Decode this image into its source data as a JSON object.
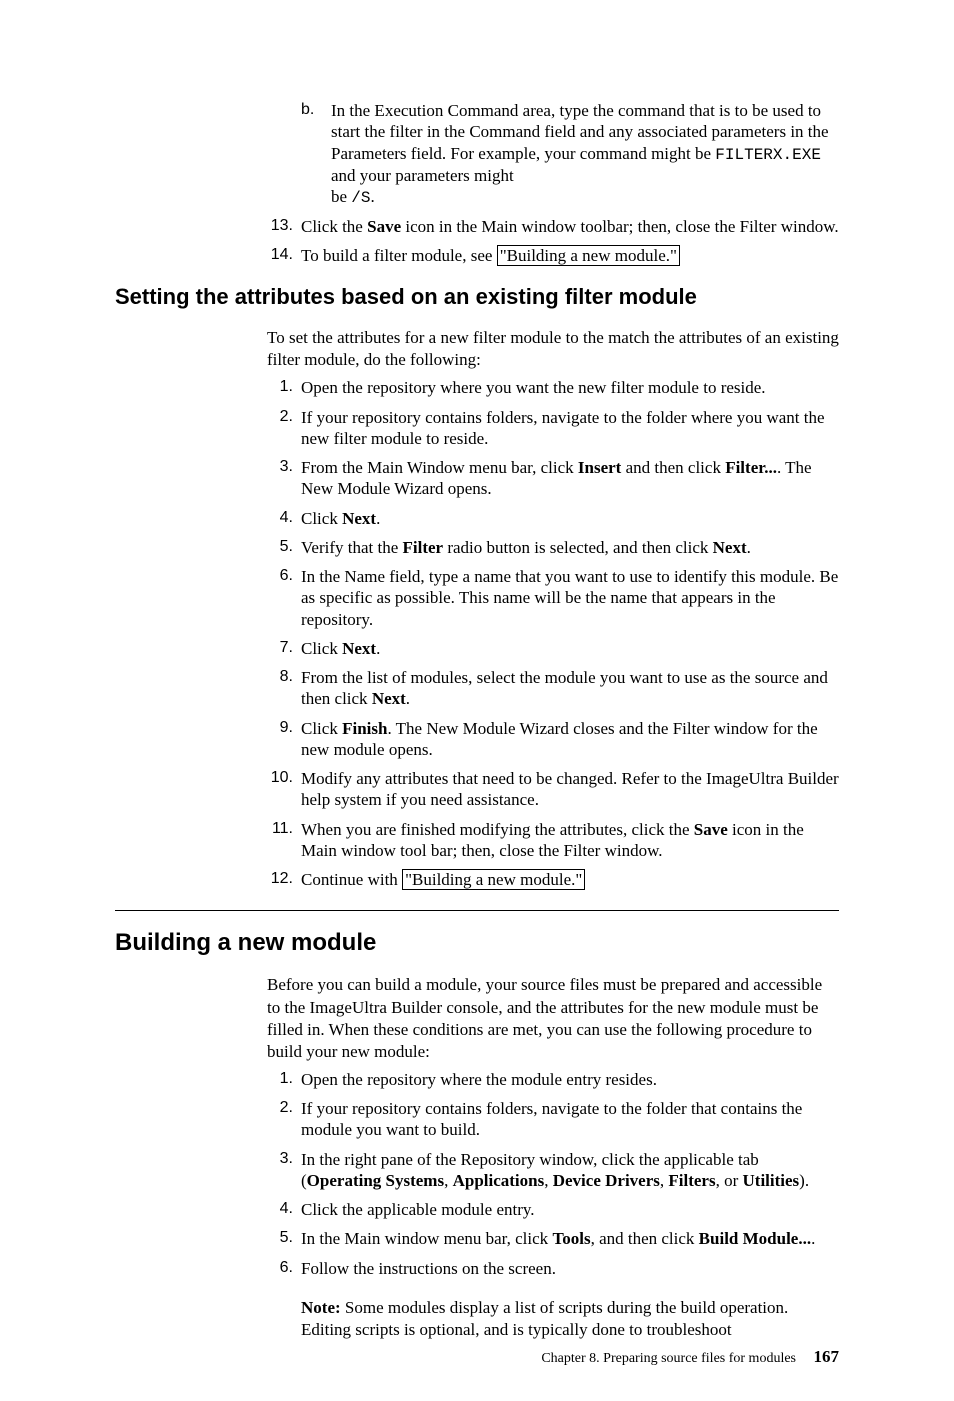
{
  "section1": {
    "step_b_letter": "b.",
    "step_b_text_p1": "In the Execution Command area, type the command that is to be used to start the filter in the Command field and any associated parameters in the Parameters field. For example, your command might be ",
    "step_b_code1": "FILTERX.EXE",
    "step_b_text_p2": " and your parameters might",
    "step_b_text_p3": "be ",
    "step_b_code2": "/S",
    "step_b_text_p4": ".",
    "step13_num": "13.",
    "step13_p1": "Click the ",
    "step13_b1": "Save",
    "step13_p2": " icon in the Main window toolbar; then, close the Filter window.",
    "step14_num": "14.",
    "step14_p1": "To build a filter module, see ",
    "step14_link": "\"Building a new module.\""
  },
  "section2": {
    "heading": "Setting the attributes based on an existing filter module",
    "intro": "To set the attributes for a new filter module to the match the attributes of an existing filter module, do the following:",
    "s1_num": "1.",
    "s1": "Open the repository where you want the new filter module to reside.",
    "s2_num": "2.",
    "s2": "If your repository contains folders, navigate to the folder where you want the new filter module to reside.",
    "s3_num": "3.",
    "s3_p1": "From the Main Window menu bar, click ",
    "s3_b1": "Insert",
    "s3_p2": " and then click ",
    "s3_b2": "Filter...",
    "s3_p3": ". The New Module Wizard opens.",
    "s4_num": "4.",
    "s4_p1": "Click ",
    "s4_b1": "Next",
    "s4_p2": ".",
    "s5_num": "5.",
    "s5_p1": "Verify that the ",
    "s5_b1": "Filter",
    "s5_p2": " radio button is selected, and then click ",
    "s5_b2": "Next",
    "s5_p3": ".",
    "s6_num": "6.",
    "s6": "In the Name field, type a name that you want to use to identify this module. Be as specific as possible. This name will be the name that appears in the repository.",
    "s7_num": "7.",
    "s7_p1": "Click ",
    "s7_b1": "Next",
    "s7_p2": ".",
    "s8_num": "8.",
    "s8_p1": "From the list of modules, select the module you want to use as the source and then click ",
    "s8_b1": "Next",
    "s8_p2": ".",
    "s9_num": "9.",
    "s9_p1": "Click ",
    "s9_b1": "Finish",
    "s9_p2": ". The New Module Wizard closes and the Filter window for the new module opens.",
    "s10_num": "10.",
    "s10": "Modify any attributes that need to be changed. Refer to the ImageUltra Builder help system if you need assistance.",
    "s11_num": "11.",
    "s11_p1": "When you are finished modifying the attributes, click the ",
    "s11_b1": "Save",
    "s11_p2": " icon in the Main window tool bar; then, close the Filter window.",
    "s12_num": "12.",
    "s12_p1": "Continue with ",
    "s12_link": "\"Building a new module.\""
  },
  "section3": {
    "heading": "Building a new module",
    "intro": "Before you can build a module, your source files must be prepared and accessible to the ImageUltra Builder console, and the attributes for the new module must be filled in. When these conditions are met, you can use the following procedure to build your new module:",
    "s1_num": "1.",
    "s1": "Open the repository where the module entry resides.",
    "s2_num": "2.",
    "s2": "If your repository contains folders, navigate to the folder that contains the module you want to build.",
    "s3_num": "3.",
    "s3_p1": "In the right pane of the Repository window, click the applicable tab (",
    "s3_b1": "Operating Systems",
    "s3_p2": ", ",
    "s3_b2": "Applications",
    "s3_p3": ", ",
    "s3_b3": "Device Drivers",
    "s3_p4": ", ",
    "s3_b4": "Filters",
    "s3_p5": ", or ",
    "s3_b5": "Utilities",
    "s3_p6": ").",
    "s4_num": "4.",
    "s4": "Click the applicable module entry.",
    "s5_num": "5.",
    "s5_p1": "In the Main window menu bar, click ",
    "s5_b1": "Tools",
    "s5_p2": ", and then click ",
    "s5_b2": "Build Module...",
    "s5_p3": ".",
    "s6_num": "6.",
    "s6": "Follow the instructions on the screen.",
    "note_label": "Note:",
    "note_text": " Some modules display a list of scripts during the build operation. Editing scripts is optional, and is typically done to troubleshoot"
  },
  "footer": {
    "chapter": "Chapter 8. Preparing source files for modules",
    "page": "167"
  }
}
